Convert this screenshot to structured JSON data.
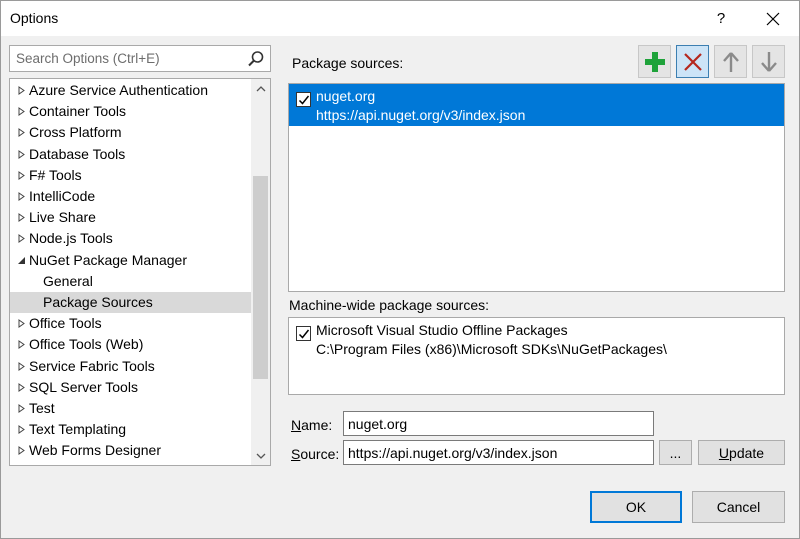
{
  "window": {
    "title": "Options",
    "help_label": "?"
  },
  "search": {
    "placeholder": "Search Options (Ctrl+E)"
  },
  "tree": {
    "items": [
      {
        "label": "Azure Service Authentication",
        "expanded": false,
        "child": false
      },
      {
        "label": "Container Tools",
        "expanded": false,
        "child": false
      },
      {
        "label": "Cross Platform",
        "expanded": false,
        "child": false
      },
      {
        "label": "Database Tools",
        "expanded": false,
        "child": false
      },
      {
        "label": "F# Tools",
        "expanded": false,
        "child": false
      },
      {
        "label": "IntelliCode",
        "expanded": false,
        "child": false
      },
      {
        "label": "Live Share",
        "expanded": false,
        "child": false
      },
      {
        "label": "Node.js Tools",
        "expanded": false,
        "child": false
      },
      {
        "label": "NuGet Package Manager",
        "expanded": true,
        "child": false
      },
      {
        "label": "General",
        "expanded": false,
        "child": true
      },
      {
        "label": "Package Sources",
        "expanded": false,
        "child": true,
        "selected": true
      },
      {
        "label": "Office Tools",
        "expanded": false,
        "child": false
      },
      {
        "label": "Office Tools (Web)",
        "expanded": false,
        "child": false
      },
      {
        "label": "Service Fabric Tools",
        "expanded": false,
        "child": false
      },
      {
        "label": "SQL Server Tools",
        "expanded": false,
        "child": false
      },
      {
        "label": "Test",
        "expanded": false,
        "child": false
      },
      {
        "label": "Text Templating",
        "expanded": false,
        "child": false
      },
      {
        "label": "Web Forms Designer",
        "expanded": false,
        "child": false
      }
    ]
  },
  "package_sources": {
    "label": "Package sources:",
    "items": [
      {
        "name": "nuget.org",
        "url": "https://api.nuget.org/v3/index.json",
        "checked": true,
        "selected": true
      }
    ]
  },
  "machine_sources": {
    "label": "Machine-wide package sources:",
    "items": [
      {
        "name": "Microsoft Visual Studio Offline Packages",
        "url": "C:\\Program Files (x86)\\Microsoft SDKs\\NuGetPackages\\",
        "checked": true
      }
    ]
  },
  "form": {
    "name_label_key": "N",
    "name_label_rest": "ame:",
    "name_value": "nuget.org",
    "source_label_key": "S",
    "source_label_rest": "ource:",
    "source_value": "https://api.nuget.org/v3/index.json",
    "browse_label": "...",
    "update_label_key": "U",
    "update_label_rest": "pdate"
  },
  "footer": {
    "ok_label": "OK",
    "cancel_label": "Cancel"
  },
  "colors": {
    "selection": "#0078d7",
    "add_green": "#1ea23a",
    "remove_red": "#b5271d"
  }
}
